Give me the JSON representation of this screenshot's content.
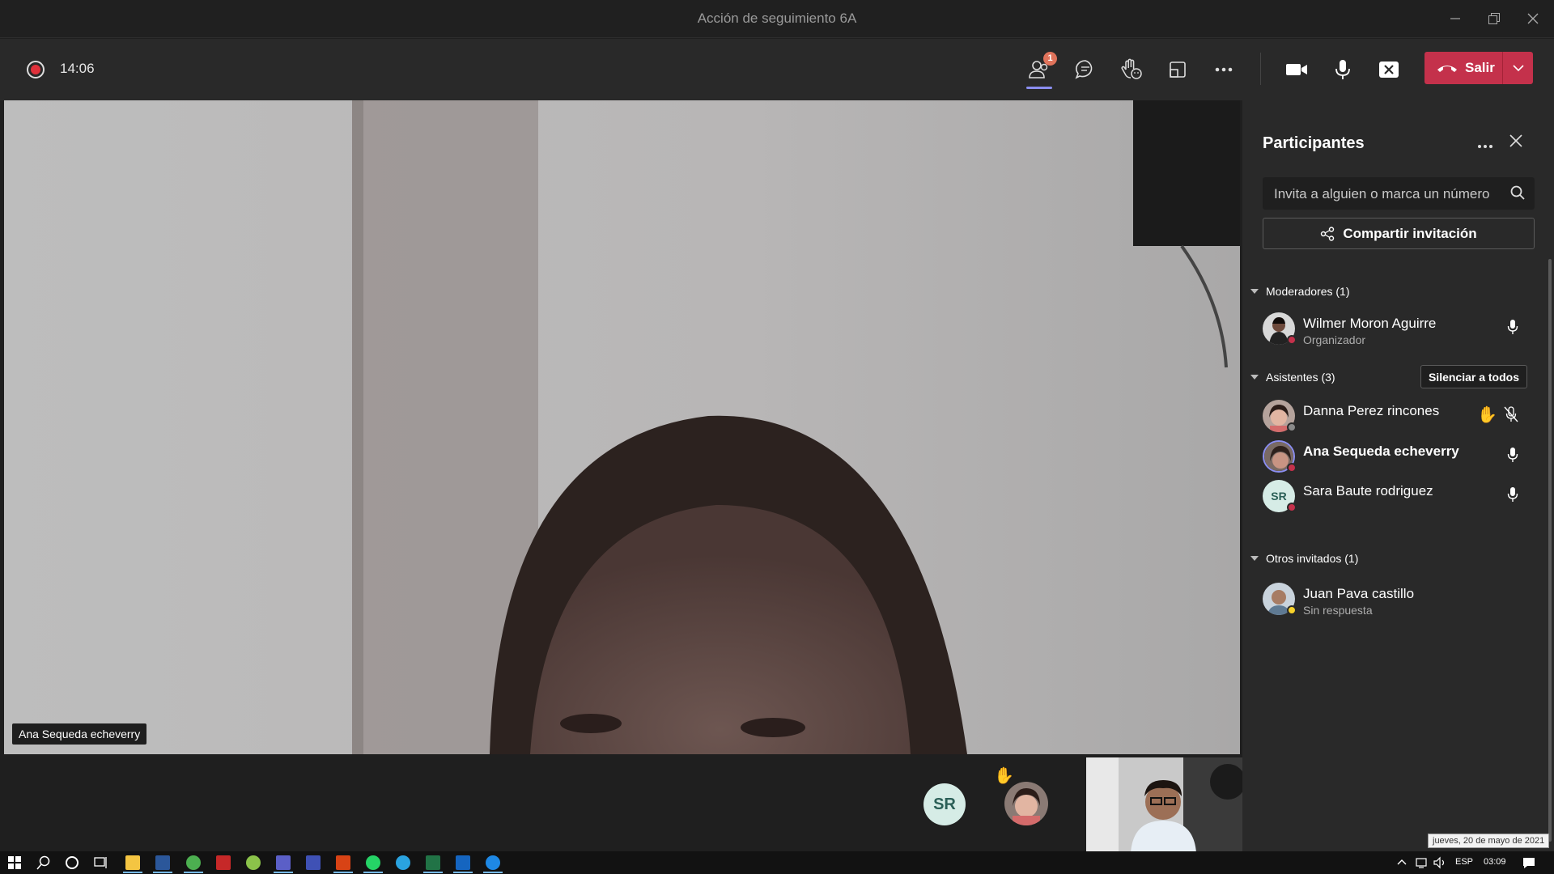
{
  "window": {
    "title": "Acción de seguimiento 6A"
  },
  "toolbar": {
    "timer": "14:06",
    "participants_badge": "1",
    "leave_label": "Salir"
  },
  "stage": {
    "speaker_name": "Ana Sequeda echeverry"
  },
  "strip": {
    "sr_initials": "SR"
  },
  "panel": {
    "title": "Participantes",
    "search_placeholder": "Invita a alguien o marca un número",
    "share_label": "Compartir invitación",
    "moderators_header": "Moderadores (1)",
    "attendees_header": "Asistentes (3)",
    "mute_all_label": "Silenciar a todos",
    "others_header": "Otros invitados (1)",
    "moderators": [
      {
        "name": "Wilmer Moron Aguirre",
        "role": "Organizador"
      }
    ],
    "attendees": [
      {
        "name": "Danna Perez rincones",
        "hand_raised": true,
        "muted": true
      },
      {
        "name": "Ana Sequeda echeverry",
        "hand_raised": false,
        "muted": false
      },
      {
        "name": "Sara Baute rodriguez",
        "initials": "SR",
        "hand_raised": false,
        "muted": false
      }
    ],
    "others": [
      {
        "name": "Juan Pava castillo",
        "status": "Sin respuesta"
      }
    ]
  },
  "taskbar": {
    "language": "ESP",
    "time": "03:09",
    "date_tooltip": "jueves, 20 de mayo de 2021"
  },
  "colors": {
    "leave_red": "#c4314b",
    "accent": "#8b8ef0",
    "record_red": "#e0313b"
  }
}
